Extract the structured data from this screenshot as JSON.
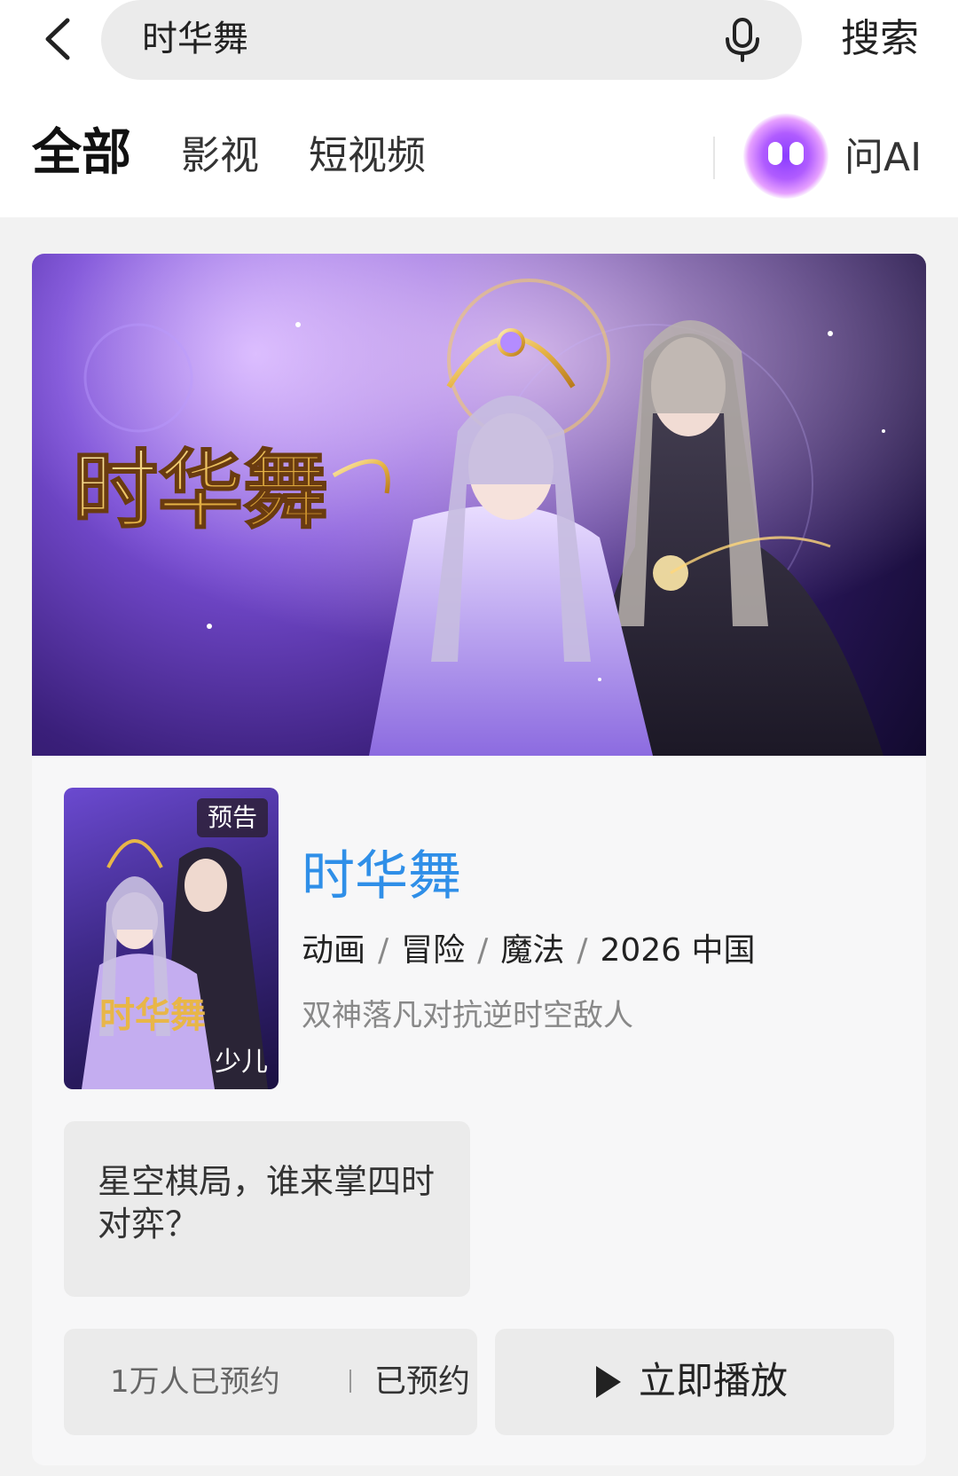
{
  "search": {
    "query": "时华舞",
    "button_label": "搜索"
  },
  "tabs": [
    {
      "label": "全部",
      "active": true
    },
    {
      "label": "影视",
      "active": false
    },
    {
      "label": "短视频",
      "active": false
    }
  ],
  "ai": {
    "label": "问AI"
  },
  "hero": {
    "logo_text": "时华舞"
  },
  "result": {
    "poster_badge": "预告",
    "poster_age": "少儿",
    "title": "时华舞",
    "tags": [
      "动画",
      "冒险",
      "魔法",
      "2026 中国"
    ],
    "tagline": "双神落凡对抗逆时空敌人",
    "quote": "星空棋局，谁来掌四时对弈？",
    "reserve_count": "1万人已预约",
    "reserve_status": "已预约",
    "play_label": "立即播放"
  },
  "colors": {
    "title_blue": "#2f8fe8",
    "accent_purple": "#8a3cff"
  },
  "icons": [
    "back-arrow-icon",
    "microphone-icon",
    "ai-assistant-icon",
    "play-icon"
  ]
}
